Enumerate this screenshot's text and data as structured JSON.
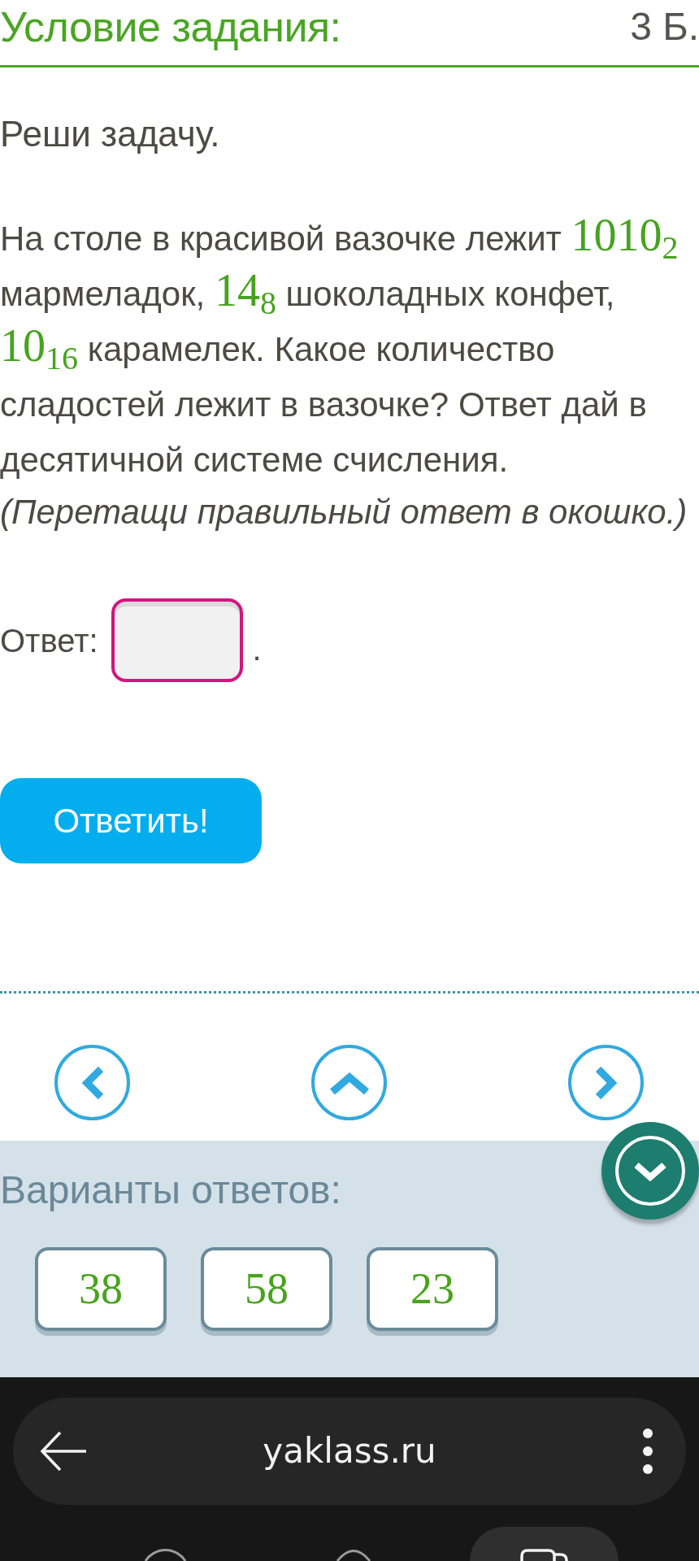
{
  "header": {
    "title": "Условие задания:",
    "points": "3 Б."
  },
  "task": {
    "heading": "Реши задачу.",
    "statement": [
      {
        "kind": "text",
        "text": "На столе в красивой вазочке лежит "
      },
      {
        "kind": "math",
        "number": "1010",
        "base": "2"
      },
      {
        "kind": "text",
        "text": " мармеладок, "
      },
      {
        "kind": "math",
        "number": "14",
        "base": "8"
      },
      {
        "kind": "text",
        "text": " шоколадных конфет, "
      },
      {
        "kind": "math",
        "number": "10",
        "base": "16"
      },
      {
        "kind": "text",
        "text": " карамелек. Какое количество сладостей лежит в вазочке? Ответ дай в десятичной системе счисления."
      }
    ],
    "instruction": "(Перетащи правильный ответ в окошко.)"
  },
  "answer": {
    "label": "Ответ:",
    "suffix": "."
  },
  "submit_button": "Ответить!",
  "variants": {
    "title": "Варианты ответов:",
    "options": [
      "38",
      "58",
      "23"
    ]
  },
  "browser": {
    "url": "yaklass.ru"
  }
}
